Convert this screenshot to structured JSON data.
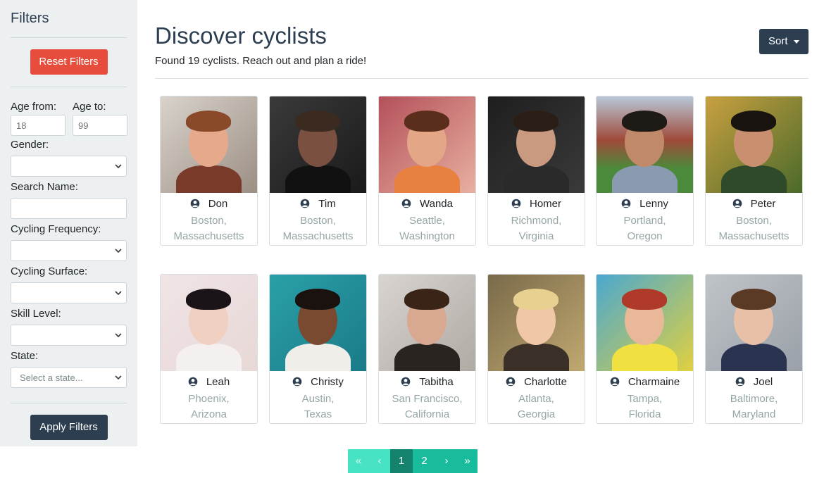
{
  "sidebar": {
    "title": "Filters",
    "reset_label": "Reset Filters",
    "apply_label": "Apply Filters",
    "age_from_label": "Age from:",
    "age_from_placeholder": "18",
    "age_to_label": "Age to:",
    "age_to_placeholder": "99",
    "gender_label": "Gender:",
    "search_name_label": "Search Name:",
    "frequency_label": "Cycling Frequency:",
    "surface_label": "Cycling Surface:",
    "skill_label": "Skill Level:",
    "state_label": "State:",
    "state_placeholder": "Select a state..."
  },
  "main": {
    "title": "Discover cyclists",
    "subtitle": "Found 19 cyclists. Reach out and plan a ride!",
    "sort_label": "Sort"
  },
  "cyclists": [
    {
      "name": "Don",
      "city": "Boston,",
      "state": "Massachusetts"
    },
    {
      "name": "Tim",
      "city": "Boston,",
      "state": "Massachusetts"
    },
    {
      "name": "Wanda",
      "city": "Seattle,",
      "state": "Washington"
    },
    {
      "name": "Homer",
      "city": "Richmond,",
      "state": "Virginia"
    },
    {
      "name": "Lenny",
      "city": "Portland,",
      "state": "Oregon"
    },
    {
      "name": "Peter",
      "city": "Boston,",
      "state": "Massachusetts"
    },
    {
      "name": "Leah",
      "city": "Phoenix,",
      "state": "Arizona"
    },
    {
      "name": "Christy",
      "city": "Austin,",
      "state": "Texas"
    },
    {
      "name": "Tabitha",
      "city": "San Francisco,",
      "state": "California"
    },
    {
      "name": "Charlotte",
      "city": "Atlanta,",
      "state": "Georgia"
    },
    {
      "name": "Charmaine",
      "city": "Tampa,",
      "state": "Florida"
    },
    {
      "name": "Joel",
      "city": "Baltimore,",
      "state": "Maryland"
    }
  ],
  "pagination": {
    "first": "«",
    "prev": "‹",
    "page1": "1",
    "page2": "2",
    "next": "›",
    "last": "»"
  },
  "colors": {
    "sidebar_bg": "#ecf0f1",
    "primary_dark": "#2c3e50",
    "danger": "#e74c3c",
    "success": "#18bc9c",
    "muted_text": "#95a5a6"
  }
}
